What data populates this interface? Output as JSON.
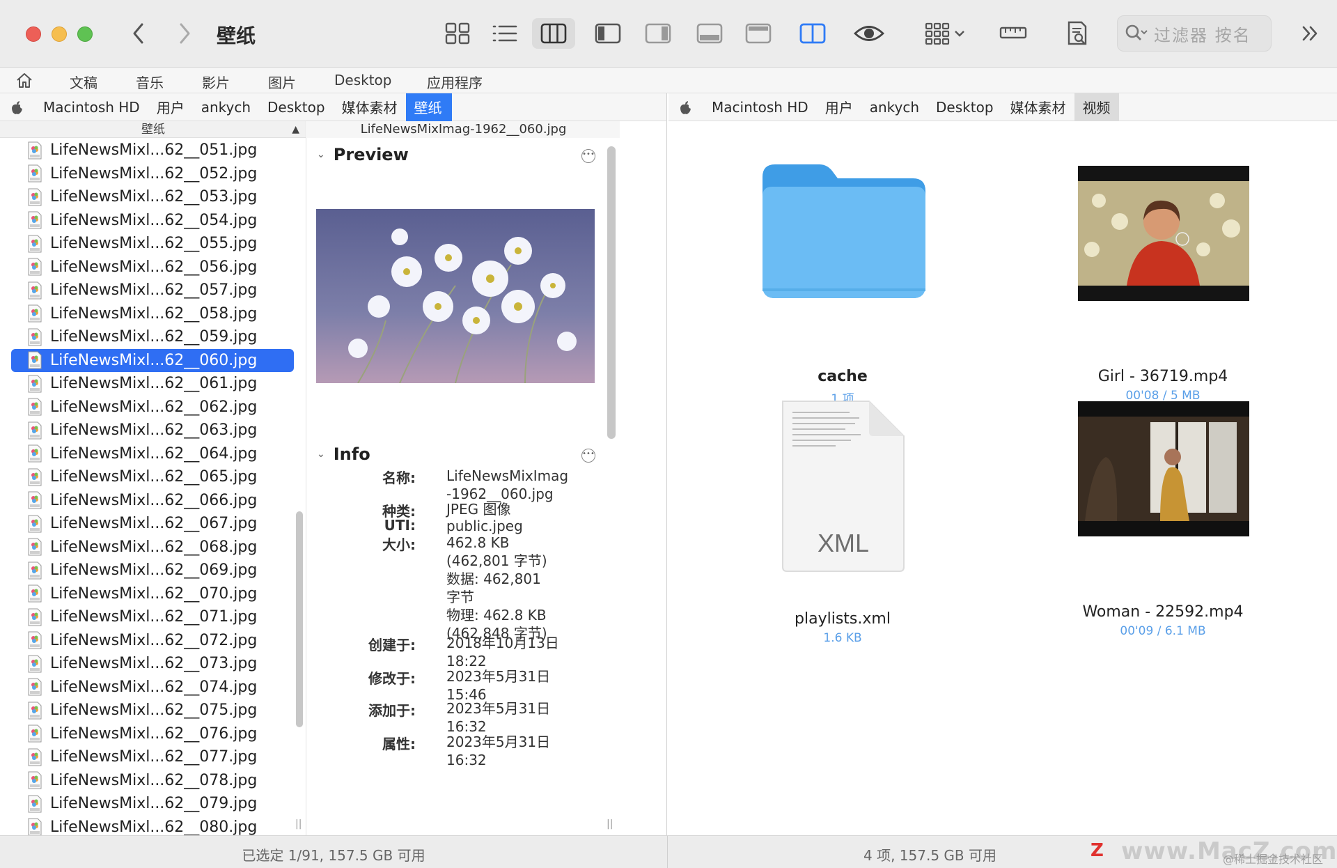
{
  "window": {
    "title": "壁纸"
  },
  "toolbar": {
    "search_placeholder": "过滤器 按名"
  },
  "favorites": [
    "文稿",
    "音乐",
    "影片",
    "图片",
    "Desktop",
    "应用程序"
  ],
  "left_path": [
    "Macintosh HD",
    "用户",
    "ankych",
    "Desktop",
    "媒体素材",
    "壁纸"
  ],
  "right_path": [
    "Macintosh HD",
    "用户",
    "ankych",
    "Desktop",
    "媒体素材",
    "视频"
  ],
  "column1": {
    "header": "壁纸",
    "files": [
      "LifeNewsMixl...62__051.jpg",
      "LifeNewsMixl...62__052.jpg",
      "LifeNewsMixl...62__053.jpg",
      "LifeNewsMixl...62__054.jpg",
      "LifeNewsMixl...62__055.jpg",
      "LifeNewsMixl...62__056.jpg",
      "LifeNewsMixl...62__057.jpg",
      "LifeNewsMixl...62__058.jpg",
      "LifeNewsMixl...62__059.jpg",
      "LifeNewsMixl...62__060.jpg",
      "LifeNewsMixl...62__061.jpg",
      "LifeNewsMixl...62__062.jpg",
      "LifeNewsMixl...62__063.jpg",
      "LifeNewsMixl...62__064.jpg",
      "LifeNewsMixl...62__065.jpg",
      "LifeNewsMixl...62__066.jpg",
      "LifeNewsMixl...62__067.jpg",
      "LifeNewsMixl...62__068.jpg",
      "LifeNewsMixl...62__069.jpg",
      "LifeNewsMixl...62__070.jpg",
      "LifeNewsMixl...62__071.jpg",
      "LifeNewsMixl...62__072.jpg",
      "LifeNewsMixl...62__073.jpg",
      "LifeNewsMixl...62__074.jpg",
      "LifeNewsMixl...62__075.jpg",
      "LifeNewsMixl...62__076.jpg",
      "LifeNewsMixl...62__077.jpg",
      "LifeNewsMixl...62__078.jpg",
      "LifeNewsMixl...62__079.jpg",
      "LifeNewsMixl...62__080.jpg"
    ],
    "selected_index": 9
  },
  "preview_pane": {
    "header": "LifeNewsMixImag-1962__060.jpg",
    "preview_title": "Preview",
    "info_title": "Info",
    "info": [
      {
        "key": "名称:",
        "value": "LifeNewsMixImag\n-1962__060.jpg"
      },
      {
        "key": "种类:",
        "value": "JPEG 图像"
      },
      {
        "key": "UTI:",
        "value": "public.jpeg"
      },
      {
        "key": "大小:",
        "value": "462.8 KB\n(462,801 字节)\n数据:  462,801\n字节\n物理:  462.8 KB\n(462,848 字节)"
      },
      {
        "key": "创建于:",
        "value": "2018年10月13日\n18:22"
      },
      {
        "key": "修改于:",
        "value": "2023年5月31日\n15:46"
      },
      {
        "key": "添加于:",
        "value": "2023年5月31日\n16:32"
      },
      {
        "key": "属性:",
        "value": "2023年5月31日\n16:32"
      }
    ]
  },
  "right_items": [
    {
      "name": "cache",
      "sub": "1 项",
      "kind": "folder"
    },
    {
      "name": "Girl - 36719.mp4",
      "sub": "00'08 / 5 MB",
      "kind": "video-girl"
    },
    {
      "name": "playlists.xml",
      "sub": "1.6 KB",
      "kind": "xml",
      "badge": "XML"
    },
    {
      "name": "Woman - 22592.mp4",
      "sub": "00'09 / 6.1 MB",
      "kind": "video-woman"
    }
  ],
  "status": {
    "left": "已选定 1/91, 157.5 GB 可用",
    "right": "4 项, 157.5 GB 可用"
  },
  "watermark": {
    "site": "www.MacZ.com",
    "note": "@稀土掘金技术社区"
  },
  "colors": {
    "selection": "#2f6ef3",
    "folder": "#5fb6f2",
    "sub_text": "#5a9fe8"
  }
}
